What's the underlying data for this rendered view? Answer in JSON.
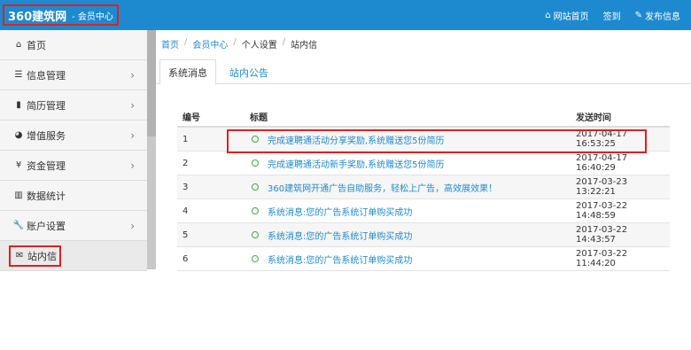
{
  "header": {
    "brand_title": "360建筑网",
    "brand_subtitle": "- 会员中心",
    "nav": [
      {
        "icon": "home-icon",
        "label": "网站首页"
      },
      {
        "label": "签到"
      },
      {
        "icon": "edit-icon",
        "label": "发布信息"
      }
    ]
  },
  "sidebar": {
    "items": [
      {
        "icon": "home-icon",
        "label": "首页",
        "has_chevron": false
      },
      {
        "icon": "list-icon",
        "label": "信息管理",
        "has_chevron": true
      },
      {
        "icon": "bookmark-icon",
        "label": "简历管理",
        "has_chevron": true
      },
      {
        "icon": "dashboard-icon",
        "label": "增值服务",
        "has_chevron": true
      },
      {
        "icon": "yen-icon",
        "label": "资金管理",
        "has_chevron": true
      },
      {
        "icon": "bar-chart-icon",
        "label": "数据统计",
        "has_chevron": false
      },
      {
        "icon": "wrench-icon",
        "label": "账户设置",
        "has_chevron": true
      },
      {
        "icon": "envelope-icon",
        "label": "站内信",
        "has_chevron": false,
        "active": true
      }
    ]
  },
  "breadcrumb": [
    "首页",
    "会员中心",
    "个人设置",
    "站内信"
  ],
  "tabs": [
    {
      "label": "系统消息",
      "active": true
    },
    {
      "label": "站内公告",
      "active": false
    }
  ],
  "table": {
    "headers": [
      "编号",
      "标题",
      "发送时间"
    ],
    "rows": [
      {
        "num": "1",
        "title": "完成速聘通活动分享奖励,系统赠送您5份简历",
        "time": "2017-04-17 16:53:25"
      },
      {
        "num": "2",
        "title": "完成速聘通活动新手奖励,系统赠送您5份简历",
        "time": "2017-04-17 16:40:29"
      },
      {
        "num": "3",
        "title": "360建筑网开通广告自助服务，轻松上广告，高效展效果！",
        "time": "2017-03-23 13:22:21"
      },
      {
        "num": "4",
        "title": "系统消息:您的广告系统订单购买成功",
        "time": "2017-03-22 14:48:59"
      },
      {
        "num": "5",
        "title": "系统消息:您的广告系统订单购买成功",
        "time": "2017-03-22 14:43:57"
      },
      {
        "num": "6",
        "title": "系统消息:您的广告系统订单购买成功",
        "time": "2017-03-22 11:44:20"
      }
    ]
  },
  "colors": {
    "header_bg": "#1d8ad0",
    "link": "#1d8ad0",
    "highlight_border": "#e02020",
    "status_circle": "#3cb043"
  }
}
